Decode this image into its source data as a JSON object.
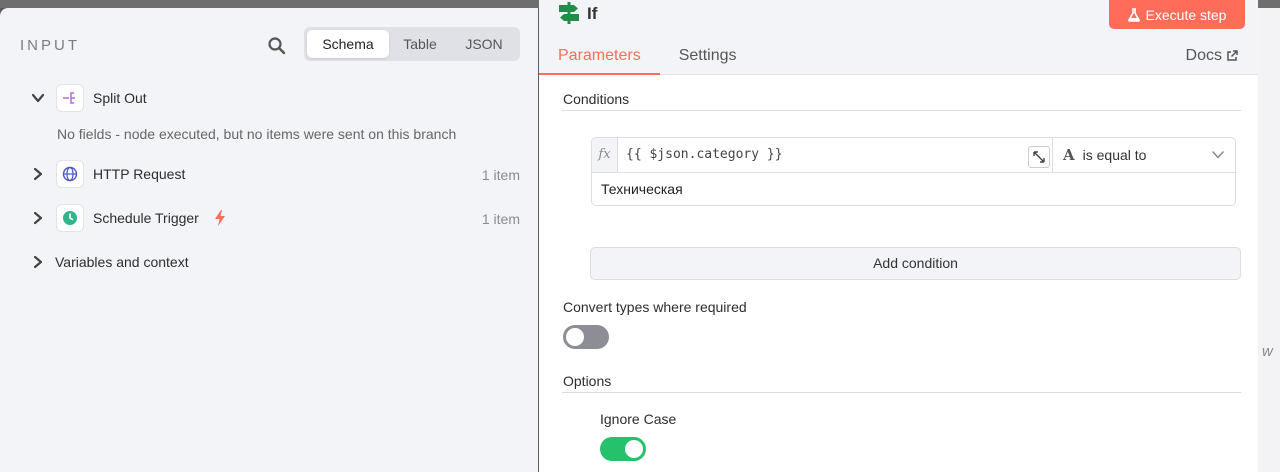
{
  "input_panel": {
    "title": "INPUT",
    "tabs": [
      {
        "label": "Schema",
        "active": true
      },
      {
        "label": "Table",
        "active": false
      },
      {
        "label": "JSON",
        "active": false
      }
    ],
    "nodes": [
      {
        "label": "Split Out",
        "expanded": true,
        "empty_message": "No fields - node executed, but no items were sent on this branch",
        "icon": "split-out-icon"
      },
      {
        "label": "HTTP Request",
        "count": "1 item",
        "icon": "globe-icon"
      },
      {
        "label": "Schedule Trigger",
        "count": "1 item",
        "icon": "clock-icon",
        "trigger_badge": "bolt-icon"
      }
    ],
    "variables_label": "Variables and context"
  },
  "node": {
    "title": "If",
    "execute_label": "Execute step",
    "tabs": [
      {
        "label": "Parameters",
        "active": true
      },
      {
        "label": "Settings",
        "active": false
      }
    ],
    "docs_label": "Docs"
  },
  "conditions": {
    "section_label": "Conditions",
    "fx_label": "fx",
    "left_value": "{{ $json.category }}",
    "operator_type": "A",
    "operator": "is equal to",
    "right_value": "Техническая",
    "add_label": "Add condition"
  },
  "convert_types": {
    "label": "Convert types where required",
    "enabled": false
  },
  "options": {
    "section_label": "Options",
    "ignore_case_label": "Ignore Case",
    "ignore_case_enabled": true
  },
  "background_glyph": "w",
  "colors": {
    "accent": "#ff6d5a",
    "toggle_on": "#26c26b",
    "toggle_off": "#8d8d96"
  }
}
